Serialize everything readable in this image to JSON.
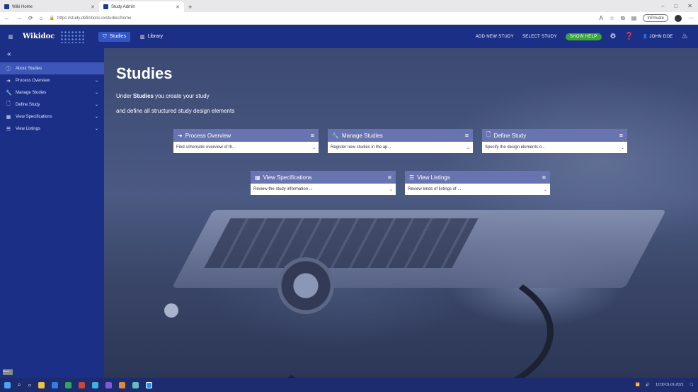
{
  "browser": {
    "tabs": [
      {
        "label": "Wiki Home",
        "active": false
      },
      {
        "label": "Study Admin",
        "active": true
      }
    ],
    "new_tab_symbol": "+",
    "url": "https://study.definitions.io/studies/home",
    "profile_label": "InPrivate"
  },
  "header": {
    "logo_text": "Wikidoc",
    "nav": [
      {
        "label": "Studies",
        "icon": "studies-icon",
        "active": true
      },
      {
        "label": "Library",
        "icon": "library-icon",
        "active": false
      }
    ],
    "links": [
      "ADD NEW STUDY",
      "SELECT STUDY"
    ],
    "status_pill": "SHOW HELP",
    "user": "JOHN DOE"
  },
  "sidebar": {
    "collapse_symbol": "«",
    "items": [
      {
        "label": "About Studies",
        "icon": "info-icon",
        "active": true,
        "chevron": false
      },
      {
        "label": "Process Overview",
        "icon": "arrow-icon",
        "active": false,
        "chevron": true
      },
      {
        "label": "Manage Studies",
        "icon": "wrench-icon",
        "active": false,
        "chevron": true
      },
      {
        "label": "Define Study",
        "icon": "document-icon",
        "active": false,
        "chevron": true
      },
      {
        "label": "View Specifications",
        "icon": "grid-icon",
        "active": false,
        "chevron": true
      },
      {
        "label": "View Listings",
        "icon": "list-icon",
        "active": false,
        "chevron": true
      }
    ],
    "bottom_tag": "Docs"
  },
  "main": {
    "title": "Studies",
    "line1_prefix": "Under ",
    "line1_bold": "Studies",
    "line1_suffix": " you create your study",
    "line2": "and define all structured study design elements",
    "cards": [
      {
        "title": "Process Overview",
        "icon": "arrow-icon",
        "text": "Find schematic overview of th..."
      },
      {
        "title": "Manage Studies",
        "icon": "wrench-icon",
        "text": "Register new studies in the ap..."
      },
      {
        "title": "Define Study",
        "icon": "document-icon",
        "text": "Specify the design elements o..."
      },
      {
        "title": "View Specifications",
        "icon": "grid-icon",
        "text": "Review the study information ..."
      },
      {
        "title": "View Listings",
        "icon": "list-icon",
        "text": "Review kinds of listings of ..."
      }
    ]
  },
  "taskbar": {
    "time": "12:00",
    "date": "01-01-2021"
  }
}
